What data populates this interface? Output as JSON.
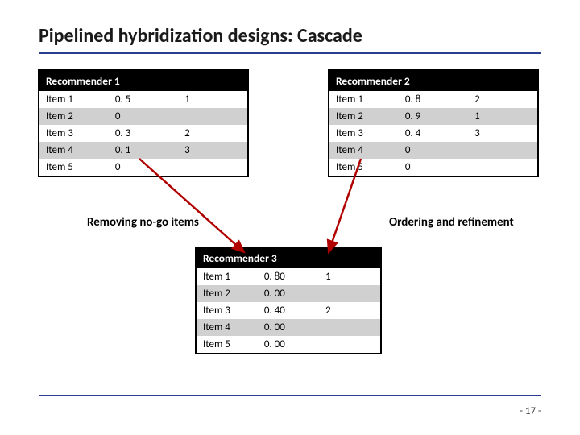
{
  "title": "Pipelined hybridization designs: Cascade",
  "page_number": "- 17 -",
  "captions": {
    "left": "Removing no-go items",
    "right": "Ordering and refinement"
  },
  "rec1": {
    "header": "Recommender 1",
    "rows": [
      {
        "item": "Item 1",
        "score": "0. 5",
        "rank": "1"
      },
      {
        "item": "Item 2",
        "score": "0",
        "rank": ""
      },
      {
        "item": "Item 3",
        "score": "0. 3",
        "rank": "2"
      },
      {
        "item": "Item 4",
        "score": "0. 1",
        "rank": "3"
      },
      {
        "item": "Item 5",
        "score": "0",
        "rank": ""
      }
    ]
  },
  "rec2": {
    "header": "Recommender 2",
    "rows": [
      {
        "item": "Item 1",
        "score": "0. 8",
        "rank": "2"
      },
      {
        "item": "Item 2",
        "score": "0. 9",
        "rank": "1"
      },
      {
        "item": "Item 3",
        "score": "0. 4",
        "rank": "3"
      },
      {
        "item": "Item 4",
        "score": "0",
        "rank": ""
      },
      {
        "item": "Item 5",
        "score": "0",
        "rank": ""
      }
    ]
  },
  "rec3": {
    "header": "Recommender 3",
    "rows": [
      {
        "item": "Item 1",
        "score": "0. 80",
        "rank": "1"
      },
      {
        "item": "Item 2",
        "score": "0. 00",
        "rank": ""
      },
      {
        "item": "Item 3",
        "score": "0. 40",
        "rank": "2"
      },
      {
        "item": "Item 4",
        "score": "0. 00",
        "rank": ""
      },
      {
        "item": "Item 5",
        "score": "0. 00",
        "rank": ""
      }
    ]
  }
}
